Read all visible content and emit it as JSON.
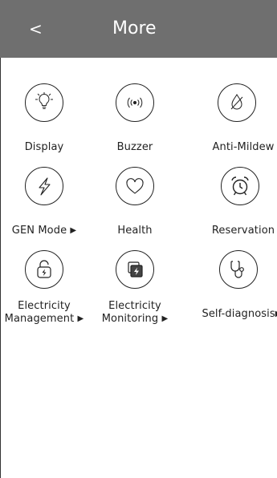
{
  "header": {
    "back_label": "<",
    "title": "More"
  },
  "items": [
    {
      "label": "Display",
      "icon": "display-bulb-icon"
    },
    {
      "label": "Buzzer",
      "icon": "buzzer-wave-icon"
    },
    {
      "label": "Anti-Mildew",
      "icon": "anti-mildew-icon"
    },
    {
      "label": "GEN Mode",
      "arrow": "▶",
      "icon": "gen-mode-bolt-icon"
    },
    {
      "label": "Health",
      "icon": "health-heart-icon"
    },
    {
      "label": "Reservation",
      "arrow": "▶",
      "icon": "reservation-alarm-icon"
    },
    {
      "label_line1": "Electricity",
      "label_line2": "Management",
      "arrow": "▶",
      "icon": "electricity-management-lock-icon"
    },
    {
      "label_line1": "Electricity",
      "label_line2": "Monitoring",
      "arrow": "▶",
      "icon": "electricity-monitoring-icon"
    },
    {
      "label": "Self-diagnosis",
      "arrow": "▶",
      "icon": "self-diagnosis-stethoscope-icon"
    }
  ],
  "colors": {
    "header_bg": "#6f6f6f",
    "header_text": "#ffffff",
    "icon_stroke": "#222222"
  }
}
